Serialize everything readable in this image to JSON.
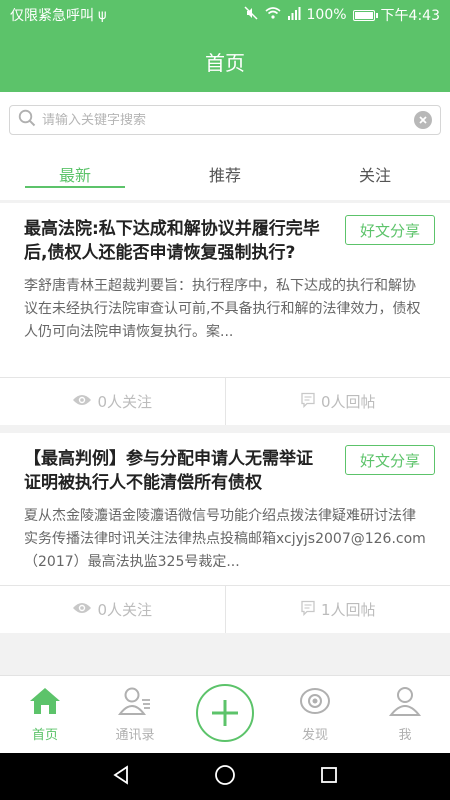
{
  "status_bar": {
    "carrier": "仅限紧急呼叫",
    "battery": "100%",
    "time": "下午4:43"
  },
  "header": {
    "title": "首页"
  },
  "search": {
    "placeholder": "请输入关键字搜索",
    "value": ""
  },
  "tabs": [
    {
      "label": "最新",
      "active": true
    },
    {
      "label": "推荐",
      "active": false
    },
    {
      "label": "关注",
      "active": false
    }
  ],
  "articles": [
    {
      "title": "最高法院:私下达成和解协议并履行完毕后,债权人还能否申请恢复强制执行?",
      "share_label": "好文分享",
      "summary": "李舒唐青林王超裁判要旨：执行程序中，私下达成的执行和解协议在未经执行法院审查认可前,不具备执行和解的法律效力，债权人仍可向法院申请恢复执行。案...",
      "followers": "0人关注",
      "replies": "0人回帖"
    },
    {
      "title": "【最高判例】参与分配申请人无需举证证明被执行人不能清偿所有债权",
      "share_label": "好文分享",
      "summary": "夏从杰金陵灋语金陵灋语微信号功能介绍点拨法律疑难研讨法律实务传播法律时讯关注法律热点投稿邮箱xcjyjs2007@126.com（2017）最高法执监325号裁定...",
      "followers": "0人关注",
      "replies": "1人回帖"
    }
  ],
  "bottom_nav": [
    {
      "label": "首页",
      "icon": "home-icon",
      "active": true
    },
    {
      "label": "通讯录",
      "icon": "contacts-icon",
      "active": false
    },
    {
      "label": "",
      "icon": "add-icon",
      "active": false
    },
    {
      "label": "发现",
      "icon": "discover-eye-icon",
      "active": false
    },
    {
      "label": "我",
      "icon": "profile-icon",
      "active": false
    }
  ],
  "colors": {
    "accent": "#5cc36a",
    "inactive": "#b0b0b0"
  }
}
